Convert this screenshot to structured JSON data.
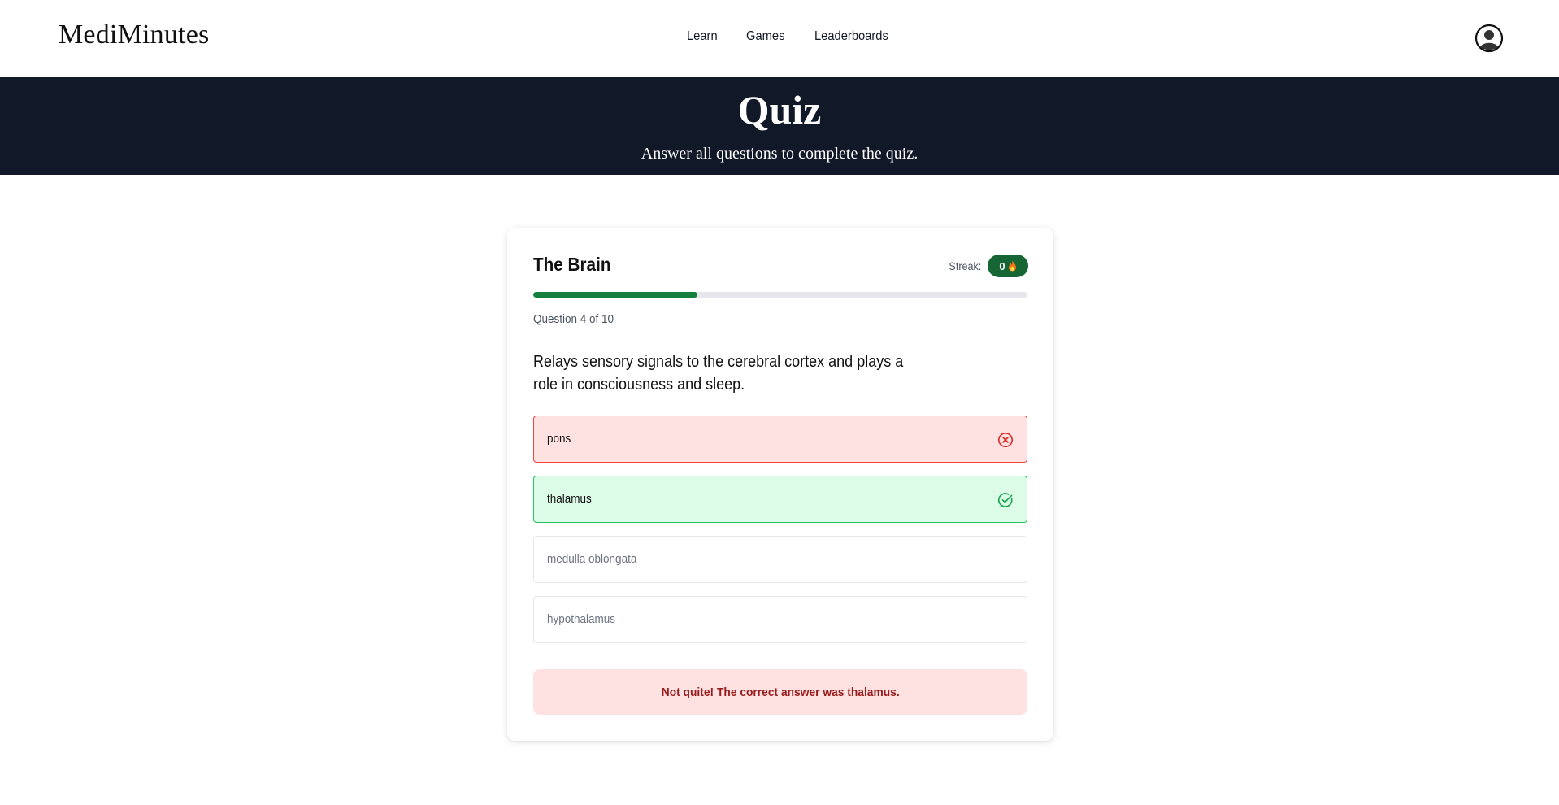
{
  "brand": "MediMinutes",
  "nav": {
    "links": [
      "Learn",
      "Games",
      "Leaderboards"
    ],
    "account_icon": "user-circle-icon"
  },
  "hero": {
    "title": "Quiz",
    "subtitle": "Answer all questions to complete the quiz."
  },
  "quiz": {
    "title": "The Brain",
    "streak_label": "Streak:",
    "streak_value": "0",
    "streak_icon": "flame-icon",
    "progress_fraction": 0.333,
    "question_counter": "Question 4 of 10",
    "question": "Relays sensory signals to the cerebral cortex and plays a role in consciousness and sleep.",
    "options": [
      {
        "label": "pons",
        "state": "incorrect",
        "icon": "x-circle-icon"
      },
      {
        "label": "thalamus",
        "state": "correct",
        "icon": "check-circle-icon"
      },
      {
        "label": "medulla oblongata",
        "state": "disabled"
      },
      {
        "label": "hypothalamus",
        "state": "disabled"
      }
    ],
    "feedback": "Not quite! The correct answer was thalamus."
  },
  "colors": {
    "hero_bg": "#111827",
    "accent_green": "#166534",
    "progress_fill": "#15803d",
    "wrong_bg": "#fee2e2",
    "wrong_border": "#ef4444",
    "right_bg": "#dcfce7",
    "right_border": "#22c55e",
    "feedback_text": "#991b1b"
  }
}
